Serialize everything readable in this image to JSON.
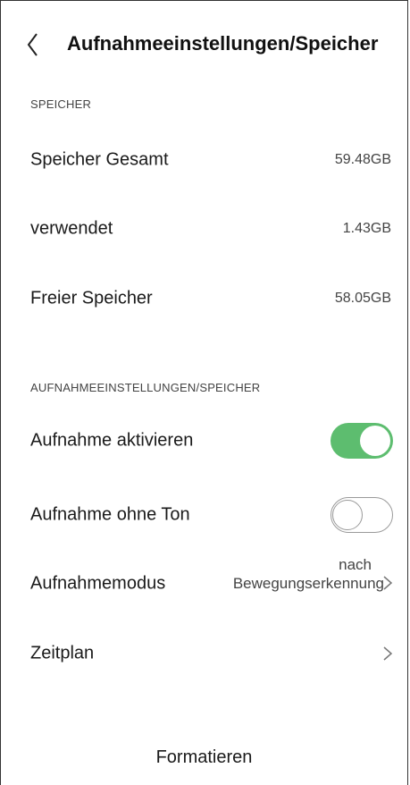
{
  "header": {
    "title": "Aufnahmeeinstellungen/Speicher",
    "back_icon": "chevron-left-icon"
  },
  "storage": {
    "section_label": "SPEICHER",
    "rows": [
      {
        "label": "Speicher Gesamt",
        "value": "59.48GB"
      },
      {
        "label": "verwendet",
        "value": "1.43GB"
      },
      {
        "label": "Freier Speicher",
        "value": "58.05GB"
      }
    ]
  },
  "recording": {
    "section_label": "AUFNAHMEEINSTELLUNGEN/SPEICHER",
    "enable": {
      "label": "Aufnahme aktivieren",
      "on": true
    },
    "mute": {
      "label": "Aufnahme ohne Ton",
      "on": false
    },
    "mode": {
      "label": "Aufnahmemodus",
      "value_line1": "nach",
      "value_line2": "Bewegungserkennung"
    },
    "schedule": {
      "label": "Zeitplan"
    }
  },
  "actions": {
    "format_label": "Formatieren"
  },
  "colors": {
    "toggle_on": "#5dbd6f",
    "toggle_off_border": "#9a9a9a"
  }
}
